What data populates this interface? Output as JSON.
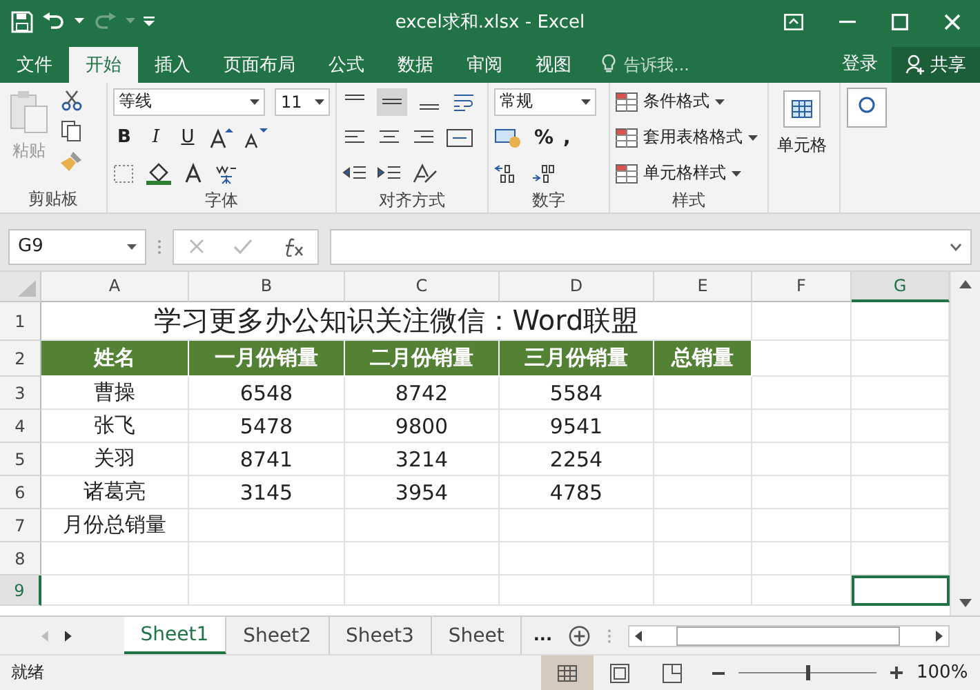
{
  "window": {
    "title": "excel求和.xlsx - Excel"
  },
  "tabs": [
    {
      "label": "文件",
      "selected": false
    },
    {
      "label": "开始",
      "selected": true
    },
    {
      "label": "插入",
      "selected": false
    },
    {
      "label": "页面布局",
      "selected": false
    },
    {
      "label": "公式",
      "selected": false
    },
    {
      "label": "数据",
      "selected": false
    },
    {
      "label": "审阅",
      "selected": false
    },
    {
      "label": "视图",
      "selected": false
    }
  ],
  "tell_me": {
    "placeholder": "告诉我..."
  },
  "account": {
    "sign_in": "登录",
    "share": "共享"
  },
  "ribbon": {
    "clipboard": {
      "paste": "粘贴",
      "label": "剪贴板"
    },
    "font": {
      "name": "等线",
      "size": "11",
      "buttons": [
        "B",
        "I",
        "U"
      ],
      "label": "字体"
    },
    "alignment": {
      "label": "对齐方式"
    },
    "number": {
      "format": "常规",
      "percent": "%",
      "comma": ",",
      "label": "数字"
    },
    "styles": {
      "items": [
        "条件格式",
        "套用表格格式",
        "单元格样式"
      ],
      "label": "样式"
    },
    "cells": {
      "label": "单元格"
    }
  },
  "formula_bar": {
    "name_box": "G9"
  },
  "sheet": {
    "columns": [
      {
        "label": "A",
        "selected": false
      },
      {
        "label": "B",
        "selected": false
      },
      {
        "label": "C",
        "selected": false
      },
      {
        "label": "D",
        "selected": false
      },
      {
        "label": "E",
        "selected": false
      },
      {
        "label": "F",
        "selected": false
      },
      {
        "label": "G",
        "selected": true
      }
    ],
    "rows": [
      {
        "number": "1",
        "kind": "title",
        "selected": false,
        "cells": [
          "学习更多办公知识关注微信：Word联盟"
        ]
      },
      {
        "number": "2",
        "kind": "header",
        "selected": false,
        "cells": [
          "姓名",
          "一月份销量",
          "二月份销量",
          "三月份销量",
          "总销量"
        ]
      },
      {
        "number": "3",
        "kind": "data",
        "selected": false,
        "cells": [
          "曹操",
          "6548",
          "8742",
          "5584"
        ]
      },
      {
        "number": "4",
        "kind": "data",
        "selected": false,
        "cells": [
          "张飞",
          "5478",
          "9800",
          "9541"
        ]
      },
      {
        "number": "5",
        "kind": "data",
        "selected": false,
        "cells": [
          "关羽",
          "8741",
          "3214",
          "2254"
        ]
      },
      {
        "number": "6",
        "kind": "data",
        "selected": false,
        "cells": [
          "诸葛亮",
          "3145",
          "3954",
          "4785"
        ]
      },
      {
        "number": "7",
        "kind": "data",
        "selected": false,
        "cells": [
          "月份总销量"
        ]
      },
      {
        "number": "8",
        "kind": "data",
        "selected": false,
        "cells": []
      },
      {
        "number": "9",
        "kind": "data",
        "selected": true,
        "cells": []
      }
    ]
  },
  "sheet_tabs": {
    "tabs": [
      {
        "label": "Sheet1",
        "selected": true
      },
      {
        "label": "Sheet2",
        "selected": false
      },
      {
        "label": "Sheet3",
        "selected": false
      },
      {
        "label": "Sheet",
        "selected": false
      }
    ],
    "overflow": "..."
  },
  "status_bar": {
    "status": "就绪",
    "view": [
      {
        "kind": "normal",
        "selected": true
      },
      {
        "kind": "page_layout",
        "selected": false
      },
      {
        "kind": "page_break",
        "selected": false
      }
    ],
    "zoom": {
      "level": 0.5,
      "reading": "100%"
    }
  }
}
